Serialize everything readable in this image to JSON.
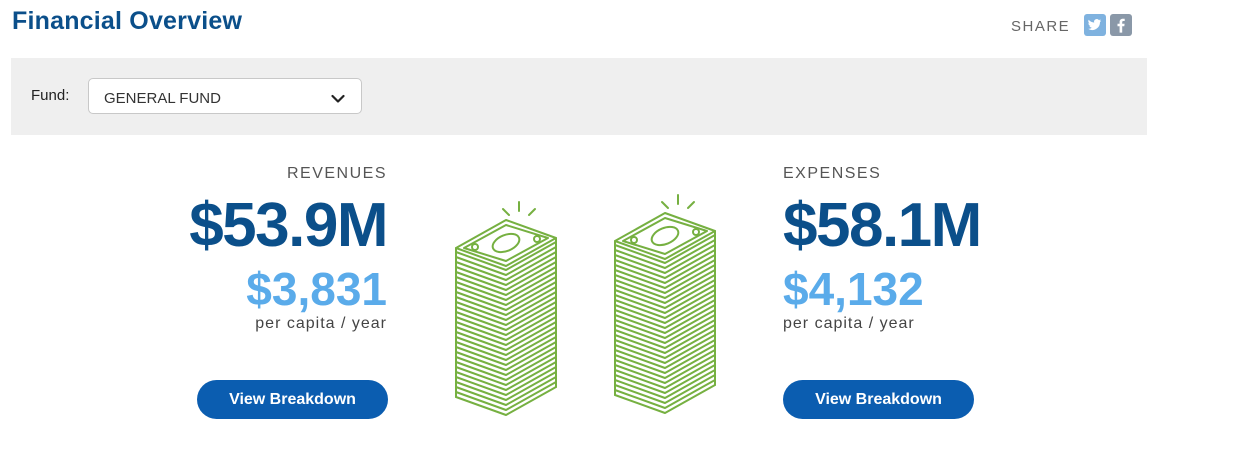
{
  "header": {
    "title": "Financial Overview",
    "share_label": "SHARE",
    "share_icons": [
      "twitter-icon",
      "facebook-icon"
    ],
    "share_icon_color": "#7fb2df"
  },
  "filter": {
    "fund_label": "Fund:",
    "fund_selected": "GENERAL FUND"
  },
  "revenues": {
    "label": "REVENUES",
    "total": "$53.9M",
    "per_capita": "$3,831",
    "per_capita_note": "per capita / year",
    "button_label": "View Breakdown"
  },
  "expenses": {
    "label": "EXPENSES",
    "total": "$58.1M",
    "per_capita": "$4,132",
    "per_capita_note": "per capita / year",
    "button_label": "View Breakdown"
  },
  "colors": {
    "title": "#0b4f8a",
    "amount": "#0b4f8a",
    "per_capita": "#5aabea",
    "button": "#0b5db0",
    "money": "#76b041",
    "filter_bar": "#efefef"
  },
  "illustration": {
    "icon": "money-stack-icon"
  }
}
